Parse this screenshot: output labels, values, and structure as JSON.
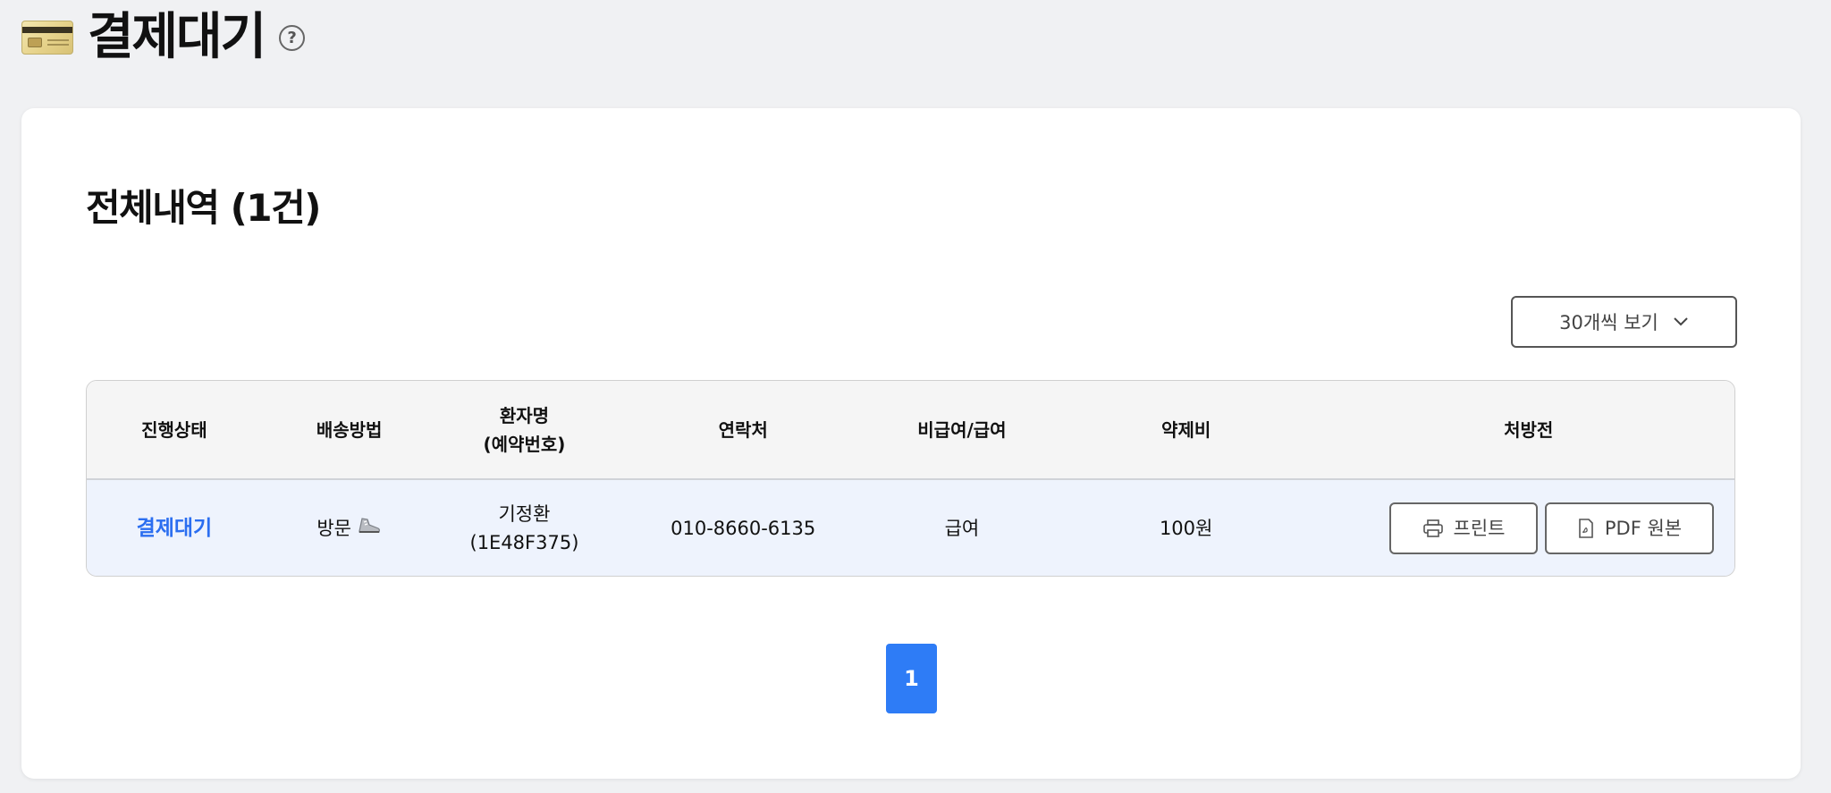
{
  "header": {
    "title": "결제대기",
    "icon": "credit-card-icon",
    "help_icon_text": "?"
  },
  "section": {
    "title": "전체내역 (1건)"
  },
  "per_page": {
    "label": "30개씩 보기",
    "icon": "chevron-down-icon"
  },
  "table": {
    "columns": [
      {
        "label": "진행상태"
      },
      {
        "label": "배송방법"
      },
      {
        "label_line1": "환자명",
        "label_line2": "(예약번호)"
      },
      {
        "label": "연락처"
      },
      {
        "label": "비급여/급여"
      },
      {
        "label": "약제비"
      },
      {
        "label": "처방전"
      }
    ],
    "rows": [
      {
        "status": "결제대기",
        "delivery": "방문",
        "delivery_icon": "shoe-icon",
        "patient_name": "기정환",
        "reservation_no": "(1E48F375)",
        "phone": "010-8660-6135",
        "coverage": "급여",
        "fee": "100원",
        "print_label": "프린트",
        "pdf_label": "PDF 원본"
      }
    ]
  },
  "pagination": {
    "current": "1"
  },
  "colors": {
    "accent": "#2e7cf6",
    "status_text": "#2b6ef0",
    "row_highlight": "#eef3fd",
    "page_bg": "#f0f1f3"
  }
}
